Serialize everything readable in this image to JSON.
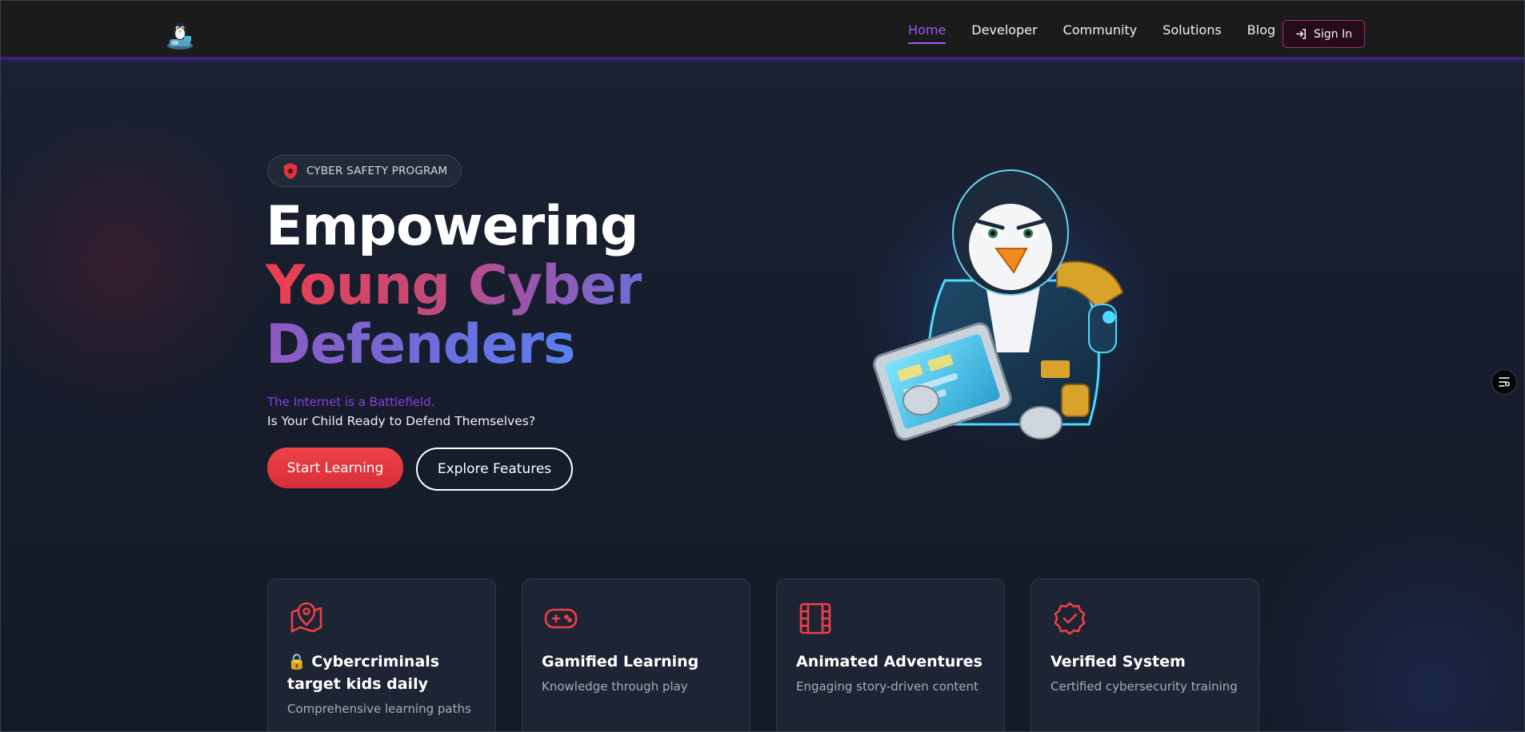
{
  "nav": {
    "items": [
      {
        "label": "Home",
        "active": true
      },
      {
        "label": "Developer",
        "active": false
      },
      {
        "label": "Community",
        "active": false
      },
      {
        "label": "Solutions",
        "active": false
      },
      {
        "label": "Blog",
        "active": false
      }
    ],
    "signin_label": "Sign In"
  },
  "hero": {
    "badge": "CYBER SAFETY PROGRAM",
    "headline_line1": "Empowering",
    "headline_line2": "Young Cyber",
    "headline_line3": "Defenders",
    "tagline": "The Internet is a Battlefield.",
    "subtagline": "Is Your Child Ready to Defend Themselves?",
    "primary_button": "Start Learning",
    "secondary_button": "Explore Features"
  },
  "features": [
    {
      "icon": "map-pin-icon",
      "title": "🔒 Cybercriminals target kids daily",
      "description": "Comprehensive learning paths"
    },
    {
      "icon": "gamepad-icon",
      "title": "Gamified Learning",
      "description": "Knowledge through play"
    },
    {
      "icon": "film-icon",
      "title": "Animated Adventures",
      "description": "Engaging story-driven content"
    },
    {
      "icon": "verified-badge-icon",
      "title": "Verified System",
      "description": "Certified cybersecurity training"
    }
  ],
  "colors": {
    "accent_purple": "#9b59f5",
    "accent_red": "#ef4146",
    "background": "#151b29",
    "navbar": "#1b1b1c",
    "card": "#1d2433"
  }
}
